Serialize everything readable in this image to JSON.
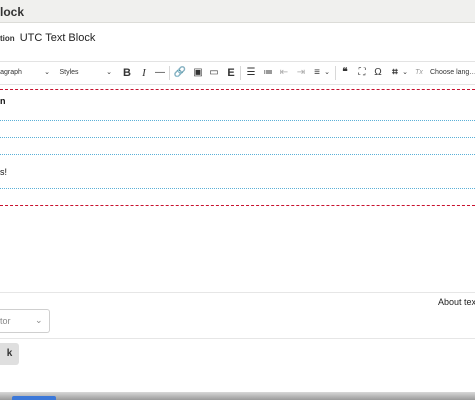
{
  "header": {
    "title": "lock"
  },
  "description": {
    "label": "tion",
    "value": "UTC Text Block"
  },
  "toolbar": {
    "paragraph": "agraph",
    "paragraph_chevron": "⌄",
    "styles": "Styles",
    "styles_chevron": "⌄",
    "bold": "B",
    "italic": "I",
    "hr": "—",
    "link": "🔗",
    "image": "▣",
    "media": "▭",
    "embed": "E",
    "bullets": "☰",
    "numbers": "≔",
    "outdent": "⇤",
    "indent": "⇥",
    "align": "≡",
    "align_chevron": "⌄",
    "quote": "❝",
    "fullscreen": "⛶",
    "omega": "Ω",
    "special": "⌗",
    "special_chevron": "⌄",
    "clear_format": "Tx",
    "language": "Choose lang…"
  },
  "editor": {
    "line1": "n",
    "line2": "s!"
  },
  "about_text": "About tex",
  "format_select": {
    "value": "tor",
    "chevron": "⌄"
  },
  "action_button": "k"
}
